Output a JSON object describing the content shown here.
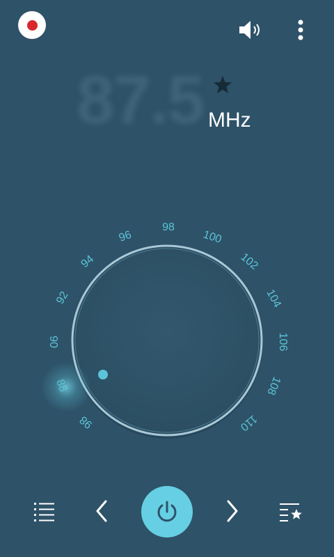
{
  "top_bar": {
    "record_icon": "record-icon",
    "volume_icon": "volume-icon",
    "more_icon": "more-vertical-icon",
    "record_color": "#d8282b"
  },
  "display": {
    "frequency": "87.5",
    "unit": "MHz",
    "favorite_icon": "star-icon"
  },
  "dial": {
    "tick_labels": [
      "88",
      "90",
      "92",
      "94",
      "96",
      "98",
      "100",
      "102",
      "104",
      "106",
      "108",
      "110",
      "98"
    ],
    "accent_color": "#5cc4d8"
  },
  "toolbar": {
    "list_icon": "station-list-icon",
    "prev_icon": "chevron-left-icon",
    "power_icon": "power-icon",
    "next_icon": "chevron-right-icon",
    "favorites_icon": "favorites-list-icon",
    "power_color": "#66cfe3"
  },
  "theme": {
    "background": "#2e5268"
  }
}
